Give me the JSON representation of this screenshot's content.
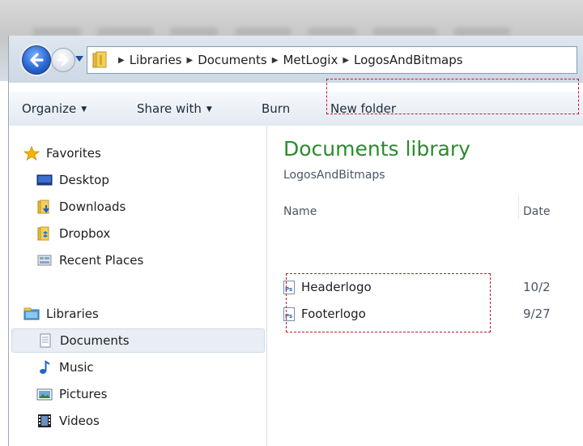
{
  "address": {
    "crumbs": [
      "Libraries",
      "Documents",
      "MetLogix",
      "LogosAndBitmaps"
    ],
    "sep": "▶"
  },
  "toolbar": {
    "organize": "Organize",
    "share": "Share with",
    "burn": "Burn",
    "new_folder": "New folder",
    "caret": "▼"
  },
  "nav": {
    "favorites": "Favorites",
    "desktop": "Desktop",
    "downloads": "Downloads",
    "dropbox": "Dropbox",
    "recent": "Recent Places",
    "libraries": "Libraries",
    "documents": "Documents",
    "music": "Music",
    "pictures": "Pictures",
    "videos": "Videos"
  },
  "content": {
    "title": "Documents library",
    "subtitle": "LogosAndBitmaps",
    "col_name": "Name",
    "col_date": "Date",
    "files": [
      {
        "name": "Headerlogo",
        "date": "10/2"
      },
      {
        "name": "Footerlogo",
        "date": "9/27"
      }
    ],
    "file_icon": "Ps"
  },
  "colors": {
    "title_green": "#2b8a2e",
    "annotation_red": "#c2182c",
    "selection": "#e9eef4"
  }
}
